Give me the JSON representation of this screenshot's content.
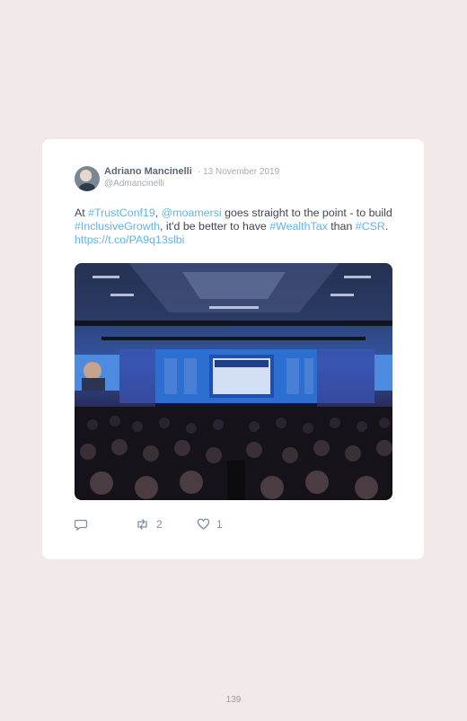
{
  "tweet": {
    "author_name": "Adriano Mancinelli",
    "date": "· 13 November 2019",
    "handle": "@Admancinelli",
    "text_parts": {
      "p1": "At ",
      "l1": "#TrustConf19",
      "p2": ", ",
      "l2": "@moamersi",
      "p3": " goes straight to the point - to build ",
      "l3": "#InclusiveGrowth",
      "p4": ", it'd be better to have ",
      "l4": "#WealthTax",
      "p5": " than ",
      "l5": "#CSR",
      "p6": ". ",
      "l6": "https://t.co/PA9q13slbi"
    },
    "actions": {
      "reply_icon": "reply-icon",
      "retweet_icon": "retweet-icon",
      "retweet_count": "2",
      "like_icon": "heart-icon",
      "like_count": "1"
    }
  },
  "page": {
    "number": "139"
  },
  "colors": {
    "background": "#f2e9ea",
    "link": "#60b4e6",
    "card": "#ffffff"
  }
}
